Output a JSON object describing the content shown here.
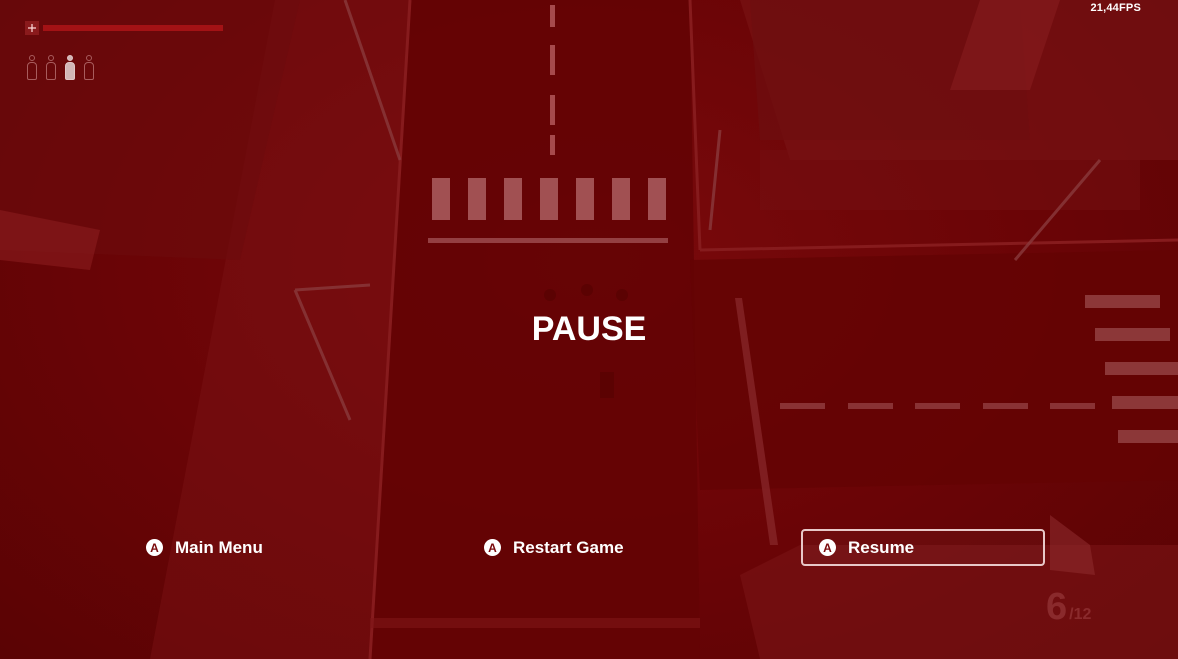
{
  "hud": {
    "fps": "21,44FPS",
    "health_fraction": 0.9,
    "hostages": [
      false,
      false,
      true,
      false
    ],
    "ammo": {
      "current": "6",
      "max": "/12"
    }
  },
  "pause": {
    "title": "PAUSE",
    "button_glyph": "A",
    "menu": [
      {
        "label": "Main Menu",
        "selected": false
      },
      {
        "label": "Restart Game",
        "selected": false
      },
      {
        "label": "Resume",
        "selected": true
      }
    ]
  },
  "colors": {
    "overlay": "#6a0406",
    "text": "#ffffff",
    "selection_border": "#e8c8c8"
  }
}
